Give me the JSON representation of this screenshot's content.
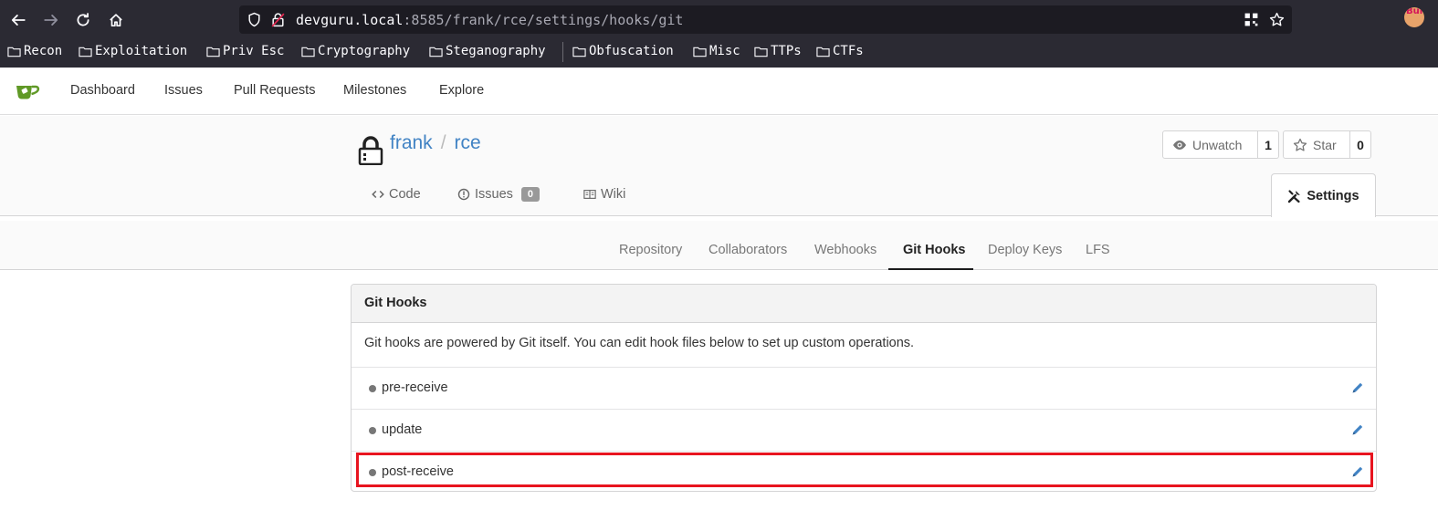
{
  "browser": {
    "url_host": "devguru.local",
    "url_rest": ":8585/frank/rce/settings/hooks/git",
    "bookmarks": [
      "Recon",
      "Exploitation",
      "Priv Esc",
      "Cryptography",
      "Steganography",
      "Obfuscation",
      "Misc",
      "TTPs",
      "CTFs"
    ],
    "profile_badge": "Bur"
  },
  "appnav": {
    "items": [
      "Dashboard",
      "Issues",
      "Pull Requests",
      "Milestones",
      "Explore"
    ]
  },
  "repo": {
    "owner": "frank",
    "separator": "/",
    "name": "rce",
    "watch_label": "Unwatch",
    "watch_count": "1",
    "star_label": "Star",
    "star_count": "0",
    "tabs": {
      "code": "Code",
      "issues": "Issues",
      "issues_count": "0",
      "wiki": "Wiki",
      "settings": "Settings"
    }
  },
  "settings_nav": {
    "items": [
      "Repository",
      "Collaborators",
      "Webhooks",
      "Git Hooks",
      "Deploy Keys",
      "LFS"
    ],
    "active": "Git Hooks"
  },
  "panel": {
    "title": "Git Hooks",
    "description": "Git hooks are powered by Git itself. You can edit hook files below to set up custom operations.",
    "hooks": [
      "pre-receive",
      "update",
      "post-receive"
    ],
    "highlighted_hook": "post-receive"
  },
  "colors": {
    "link": "#4183c4",
    "highlight_box": "#e8141f",
    "logo_green": "#609926"
  }
}
